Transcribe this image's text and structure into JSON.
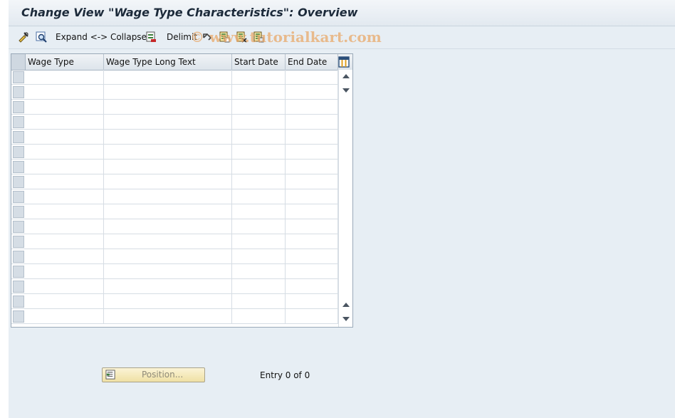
{
  "window": {
    "title": "Change View \"Wage Type Characteristics\": Overview"
  },
  "toolbar": {
    "expand_collapse_label": "Expand <-> Collapse",
    "delimit_label": "Delimit",
    "icons": [
      "display-change-icon",
      "find-icon",
      "select-block-icon",
      "undo-icon",
      "copy-icon",
      "delete-icon",
      "details-icon"
    ]
  },
  "watermark": "© www.tutorialkart.com",
  "table": {
    "columns": [
      "Wage Type",
      "Wage Type Long Text",
      "Start Date",
      "End Date"
    ],
    "row_count": 17,
    "rows": []
  },
  "footer": {
    "position_button_label": "Position...",
    "entry_text": "Entry 0 of 0"
  },
  "colors": {
    "background": "#e7eef4",
    "position_button": "#f4e9bd",
    "watermark": "#e9a96a"
  }
}
